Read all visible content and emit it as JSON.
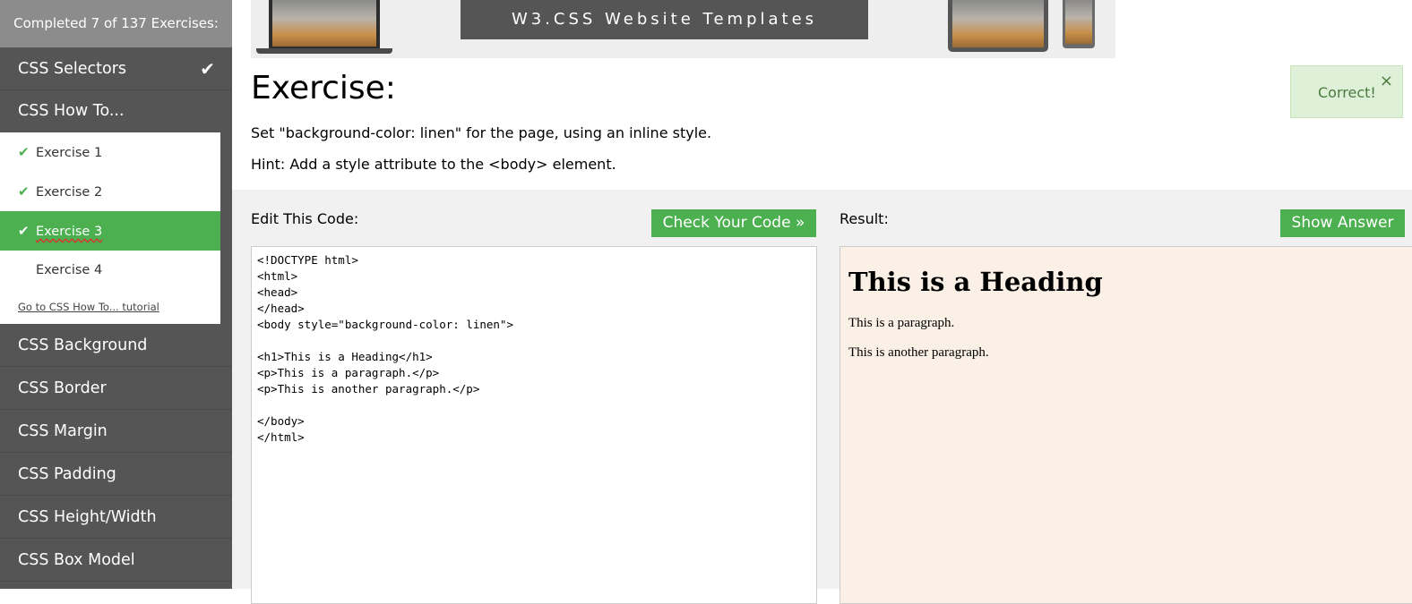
{
  "sidebar": {
    "progress": "Completed 7 of 137 Exercises:",
    "categories_top": [
      {
        "label": "CSS Selectors",
        "completed": true
      },
      {
        "label": "CSS How To...",
        "completed": false
      }
    ],
    "exercises": [
      {
        "label": "Exercise 1",
        "done": true,
        "active": false
      },
      {
        "label": "Exercise 2",
        "done": true,
        "active": false
      },
      {
        "label": "Exercise 3",
        "done": true,
        "active": true
      },
      {
        "label": "Exercise 4",
        "done": false,
        "active": false
      }
    ],
    "tutorial_link": "Go to CSS How To... tutorial",
    "categories_bottom": [
      "CSS Background",
      "CSS Border",
      "CSS Margin",
      "CSS Padding",
      "CSS Height/Width",
      "CSS Box Model"
    ]
  },
  "banner": {
    "title": "W3.CSS Website Templates"
  },
  "exercise": {
    "title": "Exercise:",
    "instruction": "Set \"background-color: linen\" for the page, using an inline style.",
    "hint": "Hint: Add a style attribute to the <body> element."
  },
  "toast": {
    "message": "Correct!",
    "close_glyph": "×",
    "color": "#dff0d8"
  },
  "editor": {
    "label": "Edit This Code:",
    "check_button": "Check Your Code »",
    "code_lines": [
      "<!DOCTYPE html>",
      "<html>",
      "<head>",
      "</head>",
      "<body style=\"background-color: linen\">",
      "",
      "<h1>This is a Heading</h1>",
      "<p>This is a paragraph.</p>",
      "<p>This is another paragraph.</p>",
      "",
      "</body>",
      "</html>"
    ]
  },
  "result": {
    "label": "Result:",
    "show_answer_button": "Show Answer",
    "background": "#faf0e6",
    "heading": "This is a Heading",
    "paragraphs": [
      "This is a paragraph.",
      "This is another paragraph."
    ]
  },
  "colors": {
    "accent_green": "#4CAF50",
    "sidebar_bg": "#555555",
    "progress_bg": "#8c8c8c"
  }
}
